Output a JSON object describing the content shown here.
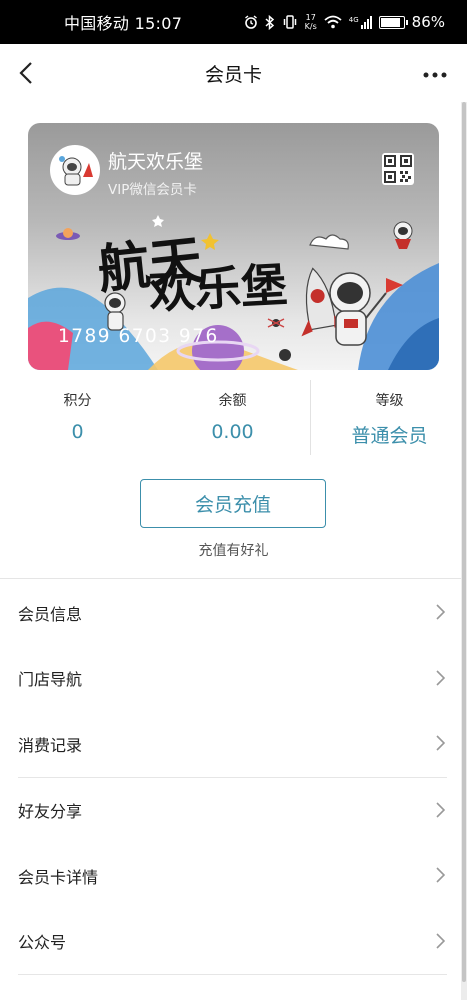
{
  "status": {
    "carrier_time": "中国移动 15:07",
    "net_speed_value": "17",
    "net_speed_unit": "K/s",
    "network_type": "4G",
    "battery": "86%",
    "battery_level": 0.86
  },
  "nav": {
    "title": "会员卡"
  },
  "card": {
    "name": "航天欢乐堡",
    "subtitle": "VIP微信会员卡",
    "number": "1789 6703 976",
    "art_title_line1": "航天",
    "art_title_line2": "欢乐堡"
  },
  "stats": [
    {
      "label": "积分",
      "value": "0"
    },
    {
      "label": "余额",
      "value": "0.00"
    },
    {
      "label": "等级",
      "value": "普通会员"
    }
  ],
  "recharge": {
    "button_label": "会员充值",
    "tip": "充值有好礼"
  },
  "menu": [
    {
      "label": "会员信息"
    },
    {
      "label": "门店导航"
    },
    {
      "label": "消费记录"
    },
    {
      "label": "好友分享"
    },
    {
      "label": "会员卡详情"
    },
    {
      "label": "公众号"
    }
  ],
  "colors": {
    "accent": "#3c8fab",
    "status_bar": "#000000"
  }
}
